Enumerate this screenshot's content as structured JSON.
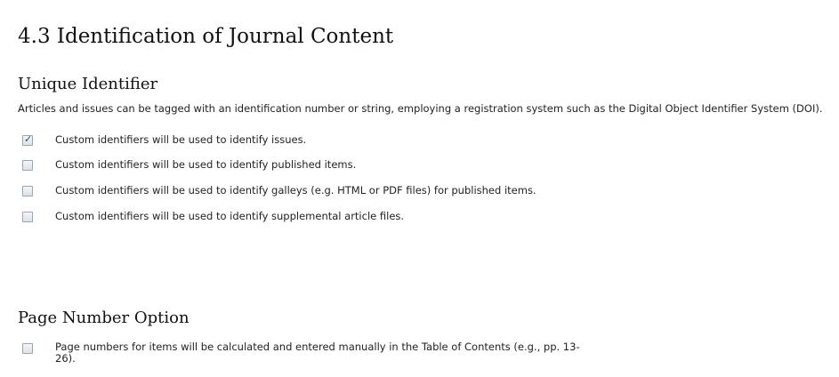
{
  "title": "4.3 Identification of Journal Content",
  "unique_identifier": {
    "heading": "Unique Identifier",
    "description": "Articles and issues can be tagged with an identification number or string, employing a registration system such as the Digital Object Identifier System (DOI).",
    "options": [
      {
        "label": "Custom identifiers will be used to identify issues.",
        "checked": true
      },
      {
        "label": "Custom identifiers will be used to identify published items.",
        "checked": false
      },
      {
        "label": "Custom identifiers will be used to identify galleys (e.g. HTML or PDF files) for published items.",
        "checked": false
      },
      {
        "label": "Custom identifiers will be used to identify supplemental article files.",
        "checked": false
      }
    ]
  },
  "page_number_option": {
    "heading": "Page Number Option",
    "option": {
      "label": "Page numbers for items will be calculated and entered manually in the Table of Contents (e.g., pp. 13-26).",
      "checked": false
    }
  },
  "icons": {
    "checkmark": "checkmark-icon"
  },
  "colors": {
    "check": "#2b3f99",
    "checkbox_border": "#9aa7b3"
  }
}
